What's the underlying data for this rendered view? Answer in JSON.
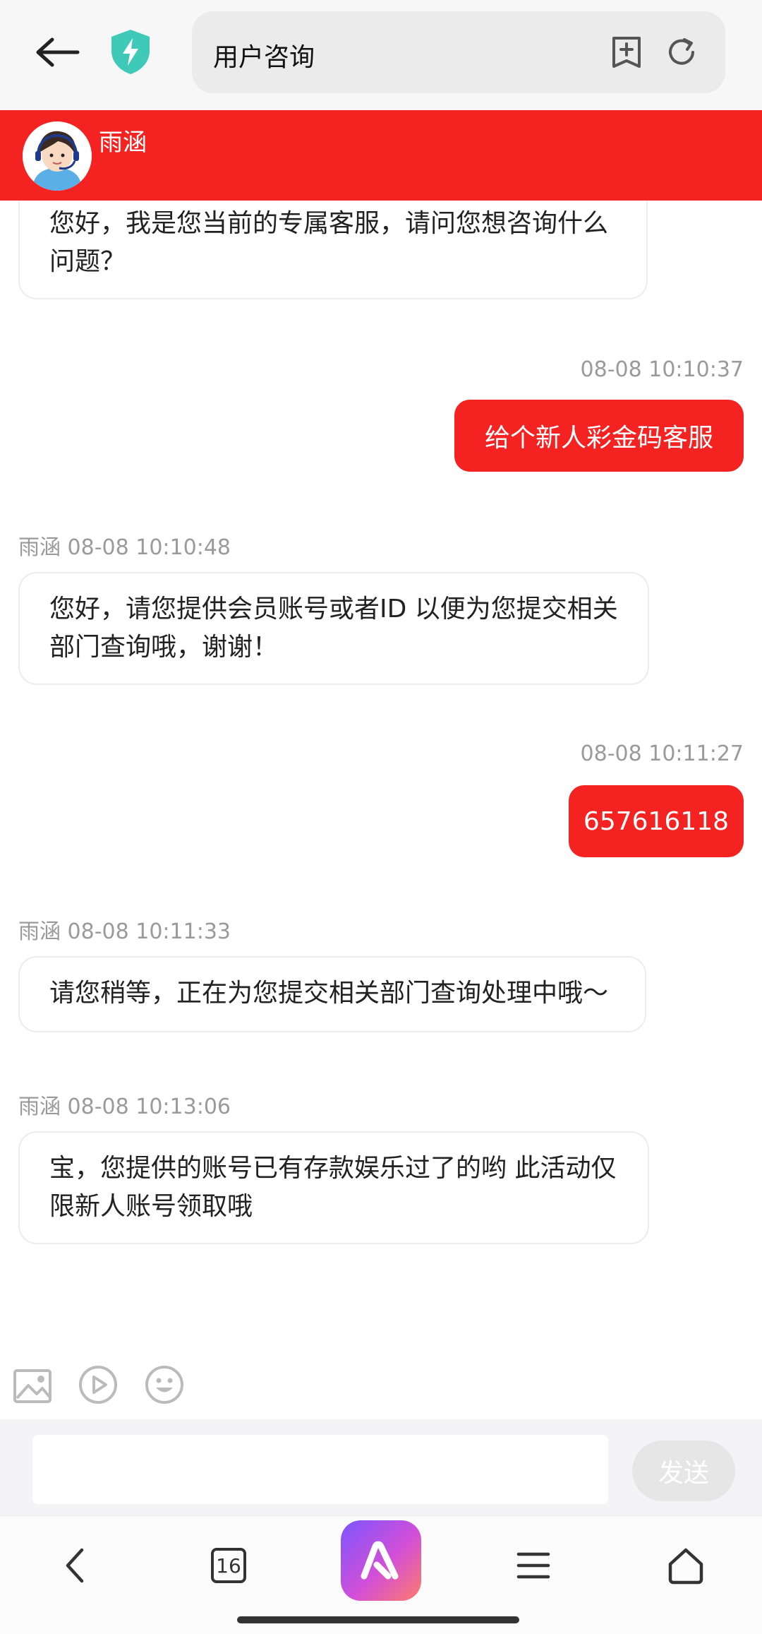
{
  "browser": {
    "page_title": "用户咨询"
  },
  "chat": {
    "agent_name": "雨涵",
    "messages": [
      {
        "from": "agent",
        "text": "您好，我是您当前的专属客服，请问您想咨询什么问题？"
      },
      {
        "from": "user",
        "time": "08-08 10:10:37",
        "text": "给个新人彩金码客服"
      },
      {
        "from": "agent",
        "sender": "雨涵",
        "time": "08-08 10:10:48",
        "text": "您好，请您提供会员账号或者ID 以便为您提交相关部门查询哦，谢谢！"
      },
      {
        "from": "user",
        "time": "08-08 10:11:27",
        "text": "657616118"
      },
      {
        "from": "agent",
        "sender": "雨涵",
        "time": "08-08 10:11:33",
        "text": "请您稍等，正在为您提交相关部门查询处理中哦～"
      },
      {
        "from": "agent",
        "sender": "雨涵",
        "time": "08-08 10:13:06",
        "text": "宝，您提供的账号已有存款娱乐过了的哟 此活动仅限新人账号领取哦"
      }
    ]
  },
  "composer": {
    "send_label": "发送",
    "tools": [
      "image-icon",
      "video-icon",
      "emoji-icon"
    ]
  },
  "navbar": {
    "tab_count": "16",
    "ai_label": "A"
  },
  "colors": {
    "accent": "#f52222",
    "shield": "#3ec9b8"
  }
}
